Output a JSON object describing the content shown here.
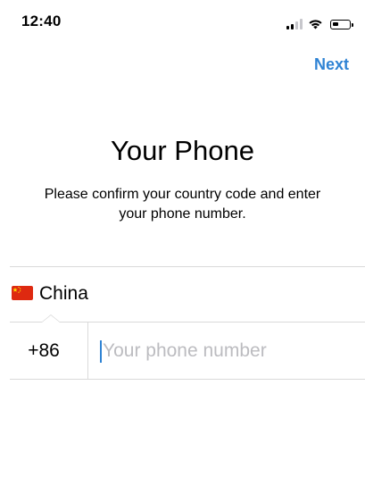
{
  "status_bar": {
    "time": "12:40",
    "icons": [
      "signal-icon",
      "wifi-icon",
      "battery-icon"
    ],
    "battery_level": 0.35
  },
  "header": {
    "next_label": "Next"
  },
  "main": {
    "title": "Your Phone",
    "subtitle": "Please confirm your country code and enter your phone number."
  },
  "country": {
    "flag_icon": "china-flag-icon",
    "name": "China"
  },
  "phone": {
    "country_code": "+86",
    "value": "",
    "placeholder": "Your phone number"
  },
  "colors": {
    "accent": "#2f83d4",
    "divider": "#dadada",
    "placeholder": "#bcbcc0",
    "flag_red": "#de2910",
    "flag_yellow": "#ffde00"
  }
}
